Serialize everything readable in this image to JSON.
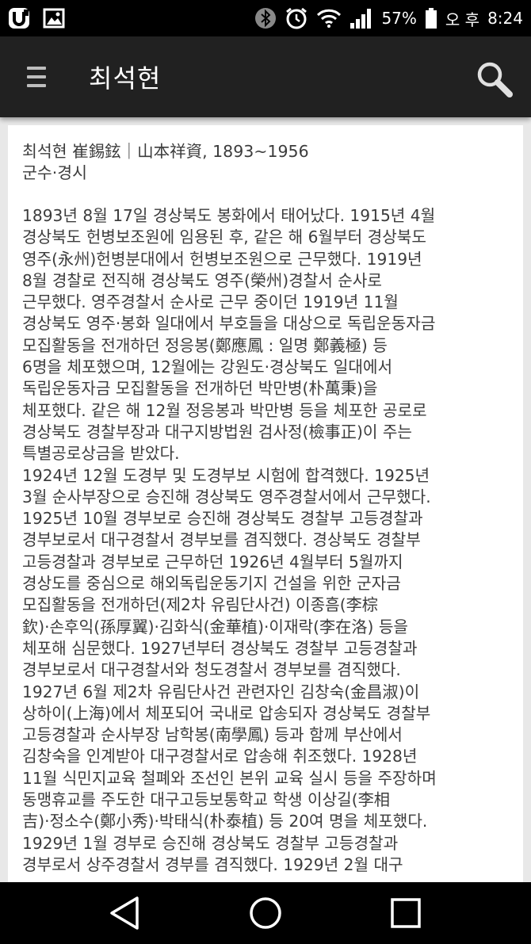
{
  "status_bar": {
    "battery_percent": "57%",
    "ampm": "오 후",
    "time": "8:24",
    "icons": [
      "app-u-icon",
      "gallery-icon",
      "bluetooth-icon",
      "alarm-icon",
      "wifi-icon",
      "signal-icon",
      "battery-icon"
    ]
  },
  "app_bar": {
    "title": "최석현",
    "menu_icon": "menu-icon",
    "search_icon": "search-icon"
  },
  "article": {
    "heading_lines": [
      "최석현 崔錫鉉｜山本祥資, 1893~1956",
      "군수·경시"
    ],
    "body_lines": [
      "1893년 8월 17일 경상북도 봉화에서 태어났다. 1915년 4월",
      "경상북도 헌병보조원에 임용된 후, 같은 해 6월부터 경상북도",
      "영주(永州)헌병분대에서 헌병보조원으로 근무했다. 1919년",
      "8월 경찰로 전직해 경상북도 영주(榮州)경찰서 순사로",
      "근무했다. 영주경찰서 순사로 근무 중이던 1919년 11월",
      "경상북도 영주·봉화 일대에서 부호들을 대상으로 독립운동자금",
      "모집활동을 전개하던 정응봉(鄭應鳳 : 일명 鄭義極) 등",
      "6명을 체포했으며, 12월에는 강원도·경상북도 일대에서",
      "독립운동자금 모집활동을 전개하던 박만병(朴萬秉)을",
      "체포했다. 같은 해 12월 정응봉과 박만병 등을 체포한 공로로",
      "경상북도 경찰부장과 대구지방법원 검사정(檢事正)이 주는",
      "특별공로상금을 받았다.",
      "1924년 12월 도경부 및 도경부보 시험에 합격했다. 1925년",
      "3월 순사부장으로 승진해 경상북도 영주경찰서에서 근무했다.",
      "1925년 10월 경부보로 승진해 경상북도 경찰부 고등경찰과",
      "경부보로서 대구경찰서 경부보를 겸직했다. 경상북도 경찰부",
      "고등경찰과 경부보로 근무하던 1926년 4월부터 5월까지",
      "경상도를 중심으로 해외독립운동기지 건설을 위한 군자금",
      "모집활동을 전개하던(제2차 유림단사건) 이종흠(李棕",
      "欽)·손후익(孫厚翼)·김화식(金華植)·이재락(李在洛) 등을",
      "체포해 심문했다. 1927년부터 경상북도 경찰부 고등경찰과",
      "경부보로서 대구경찰서와 청도경찰서 경부보를 겸직했다.",
      "1927년 6월 제2차 유림단사건 관련자인 김창숙(金昌淑)이",
      "상하이(上海)에서 체포되어 국내로 압송되자 경상북도 경찰부",
      "고등경찰과 순사부장 남학봉(南學鳳) 등과 함께 부산에서",
      "김창숙을 인계받아 대구경찰서로 압송해 취조했다. 1928년",
      "11월 식민지교육 철폐와 조선인 본위 교육 실시 등을 주장하며",
      "동맹휴교를 주도한 대구고등보통학교 학생 이상길(李相",
      "吉)·정소수(鄭小秀)·박태식(朴泰植) 등 20여 명을 체포했다.",
      "1929년 1월 경부로 승진해 경상북도 경찰부 고등경찰과",
      "경부로서 상주경찰서 경부를 겸직했다. 1929년 2월 대구"
    ]
  },
  "nav_bar": {
    "icons": [
      "back-icon",
      "home-icon",
      "recents-icon"
    ]
  }
}
